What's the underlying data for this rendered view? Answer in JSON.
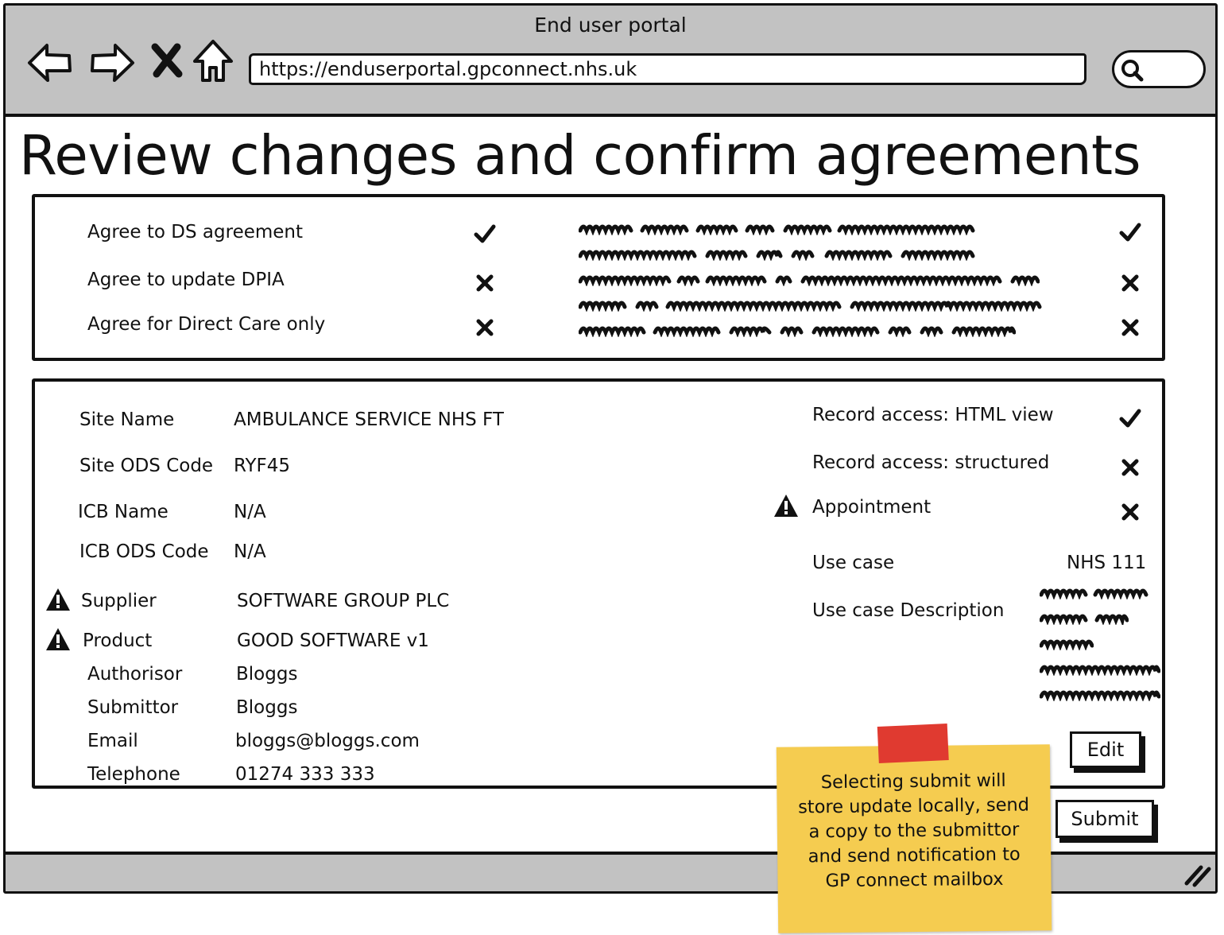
{
  "window": {
    "title": "End user portal",
    "url": "https://enduserportal.gpconnect.nhs.uk"
  },
  "page": {
    "title": "Review changes and confirm agreements"
  },
  "agreements": [
    {
      "label": "Agree to DS agreement",
      "status": "check",
      "right_status": "check"
    },
    {
      "label": "Agree to update DPIA",
      "status": "cross",
      "right_status": "cross"
    },
    {
      "label": "Agree for Direct Care only",
      "status": "cross",
      "right_status": "cross"
    }
  ],
  "details": {
    "site_name_label": "Site Name",
    "site_name_value": "AMBULANCE SERVICE NHS FT",
    "site_ods_label": "Site ODS Code",
    "site_ods_value": "RYF45",
    "icb_name_label": "ICB Name",
    "icb_name_value": "N/A",
    "icb_ods_label": "ICB ODS Code",
    "icb_ods_value": "N/A",
    "supplier_label": "Supplier",
    "supplier_value": "SOFTWARE GROUP PLC",
    "product_label": "Product",
    "product_value": "GOOD SOFTWARE v1",
    "authorisor_label": "Authorisor",
    "authorisor_value": "Bloggs",
    "submittor_label": "Submittor",
    "submittor_value": "Bloggs",
    "email_label": "Email",
    "email_value": "bloggs@bloggs.com",
    "telephone_label": "Telephone",
    "telephone_value": "01274 333 333"
  },
  "access": {
    "html_view_label": "Record access: HTML view",
    "html_view_status": "check",
    "structured_label": "Record access: structured",
    "structured_status": "cross",
    "appointment_label": "Appointment",
    "appointment_status": "cross",
    "use_case_label": "Use case",
    "use_case_value": "NHS 111",
    "use_case_desc_label": "Use case Description"
  },
  "buttons": {
    "edit": "Edit",
    "submit": "Submit"
  },
  "note": {
    "line1": "Selecting submit will",
    "line2": "store update locally, send",
    "line3": "a copy to the submittor",
    "line4": "and send notification to",
    "line5": "GP connect mailbox"
  },
  "icons": {
    "back": "back-arrow-icon",
    "forward": "forward-arrow-icon",
    "stop": "close-icon",
    "home": "home-icon",
    "search": "search-icon",
    "check": "check-icon",
    "cross": "cross-icon",
    "warning": "warning-icon"
  }
}
